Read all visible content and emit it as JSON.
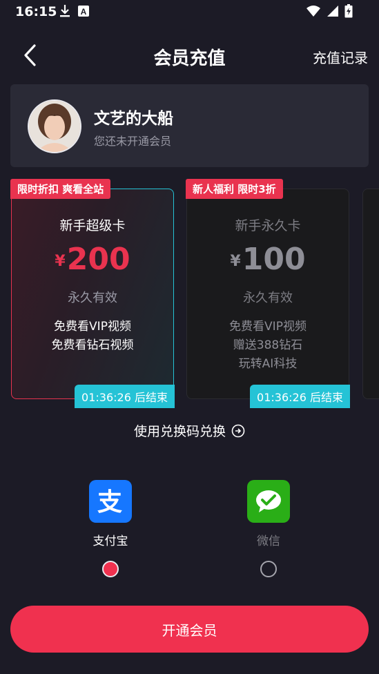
{
  "status_bar": {
    "time": "16:15",
    "icons": [
      "download-icon",
      "a-icon",
      "wifi-icon",
      "signal-icon",
      "battery-icon"
    ]
  },
  "header": {
    "title": "会员充值",
    "records_link": "充值记录"
  },
  "profile": {
    "name": "文艺的大船",
    "status": "您还未开通会员"
  },
  "cards": [
    {
      "badge": "限时折扣 爽看全站",
      "name": "新手超级卡",
      "currency": "¥",
      "price": "200",
      "validity": "永久有效",
      "features": [
        "免费看VIP视频",
        "免费看钻石视频"
      ],
      "timer": "01:36:26 后结束",
      "selected": true
    },
    {
      "badge": "新人福利 限时3折",
      "name": "新手永久卡",
      "currency": "¥",
      "price": "100",
      "validity": "永久有效",
      "features": [
        "免费看VIP视频",
        "赠送388钻石",
        "玩转AI科技"
      ],
      "timer": "01:36:26 后结束",
      "selected": false
    }
  ],
  "redeem": {
    "label": "使用兑换码兑换"
  },
  "payments": [
    {
      "label": "支付宝",
      "icon": "alipay-icon",
      "color": "#1677ff",
      "selected": true
    },
    {
      "label": "微信",
      "icon": "wechat-icon",
      "color": "#2aae17",
      "selected": false
    }
  ],
  "cta": {
    "label": "开通会员"
  },
  "colors": {
    "accent": "#f0314f",
    "timer": "#25c3d6",
    "background": "#1c1b26"
  }
}
